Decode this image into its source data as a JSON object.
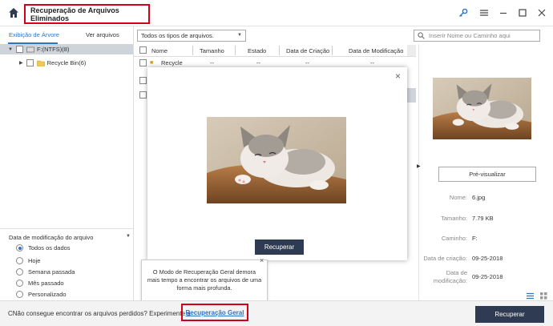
{
  "app": {
    "title": "Recuperação de Arquivos Eliminados"
  },
  "left": {
    "tabs": [
      "Exibição de Árvore",
      "Ver arquivos"
    ],
    "tree": [
      {
        "label": "F:(NTFS)(8)"
      },
      {
        "label": "Recycle Bin(6)"
      }
    ],
    "filter": {
      "title": "Data de modificação do arquivo",
      "options": [
        "Todos os dados",
        "Hoje",
        "Semana passada",
        "Mês passado",
        "Personalizado"
      ],
      "selected": "Todos os dados"
    }
  },
  "toolbar": {
    "filetype": "Todos os tipos de arquivos.",
    "search_placeholder": "Inserir Nome ou Caminho aqui"
  },
  "table": {
    "columns": [
      "Nome",
      "Tamanho",
      "Estado",
      "Data de Criação",
      "Data de Modificação"
    ],
    "row_partial": {
      "name": "Recycle",
      "size": "--",
      "state": "--",
      "created": "--",
      "modified": "--"
    }
  },
  "modal": {
    "recover_label": "Recuperar",
    "close_glyph": "×"
  },
  "tooltip": {
    "text": "O Modo de Recuperação Geral demora mais tempo a encontrar os arquivos de uma forma mais profunda.",
    "close_glyph": "×"
  },
  "preview": {
    "button_label": "Pré-visualizar",
    "fields": [
      {
        "label": "Nome:",
        "value": "6.jpg"
      },
      {
        "label": "Tamanho:",
        "value": "7.79 KB"
      },
      {
        "label": "Caminho:",
        "value": "F:"
      },
      {
        "label": "Data de criação:",
        "value": "09-25-2018"
      },
      {
        "label": "Data de modificação:",
        "value": "09-25-2018"
      }
    ]
  },
  "bottom": {
    "prompt": "CNão consegue encontrar os arquivos perdidos? Experimente a",
    "link": "Recuperação Geral",
    "recover_label": "Recuperar"
  },
  "colors": {
    "accent": "#2d74c8",
    "highlight_border": "#d0021b",
    "dark_button": "#2f3b52"
  }
}
